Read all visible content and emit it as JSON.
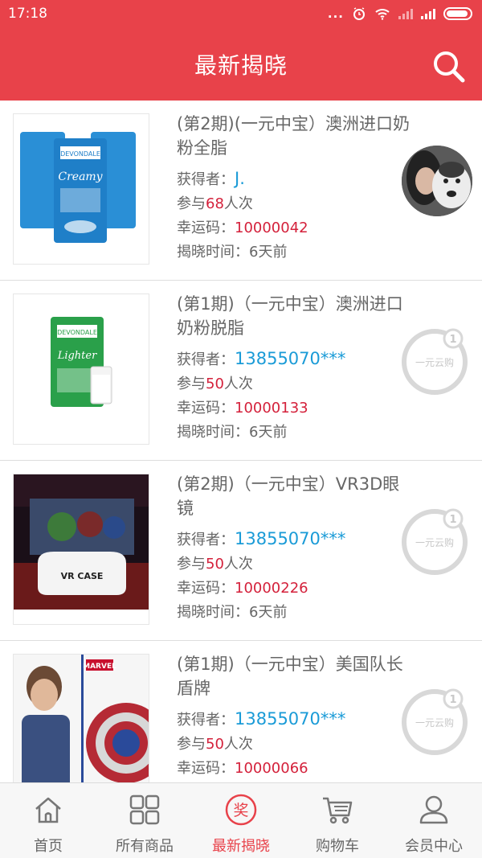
{
  "status_bar": {
    "time": "17:18",
    "dots": "..."
  },
  "header": {
    "title": "最新揭晓"
  },
  "labels": {
    "winner_prefix": "获得者：",
    "participate_prefix": "参与",
    "participate_suffix": "人次",
    "lucky_prefix": "幸运码：",
    "time_prefix": "揭晓时间：",
    "badge_text": "一元云购",
    "badge_num": "1"
  },
  "items": [
    {
      "title": "(第2期)(一元中宝）澳洲进口奶粉全脂",
      "winner": "J.",
      "count": "68",
      "lucky_code": "10000042",
      "time": "6天前",
      "marker": "avatar"
    },
    {
      "title": "(第1期)（一元中宝）澳洲进口奶粉脱脂",
      "winner": "13855070***",
      "count": "50",
      "lucky_code": "10000133",
      "time": "6天前",
      "marker": "badge"
    },
    {
      "title": "(第2期)（一元中宝）VR3D眼镜",
      "winner": "13855070***",
      "count": "50",
      "lucky_code": "10000226",
      "time": "6天前",
      "marker": "badge"
    },
    {
      "title": "(第1期)（一元中宝）美国队长盾牌",
      "winner": "13855070***",
      "count": "50",
      "lucky_code": "10000066",
      "time": "",
      "marker": "badge"
    }
  ],
  "product_art": {
    "item1": {
      "brand": "DEVONDALE",
      "name": "Creamy",
      "color": "#2a8fd6"
    },
    "item2": {
      "brand": "DEVONDALE",
      "name": "Lighter",
      "color": "#2aa04a"
    },
    "item3": {
      "name": "VR CASE"
    },
    "item4": {
      "brand": "MARVEL"
    }
  },
  "tabs": [
    {
      "label": "首页",
      "icon": "home-icon"
    },
    {
      "label": "所有商品",
      "icon": "grid-icon"
    },
    {
      "label": "最新揭晓",
      "icon": "prize-icon",
      "active": true,
      "glyph": "奖"
    },
    {
      "label": "购物车",
      "icon": "cart-icon"
    },
    {
      "label": "会员中心",
      "icon": "user-icon"
    }
  ],
  "colors": {
    "accent": "#e8424a",
    "link": "#1a9bd7",
    "highlight": "#d4213b"
  }
}
